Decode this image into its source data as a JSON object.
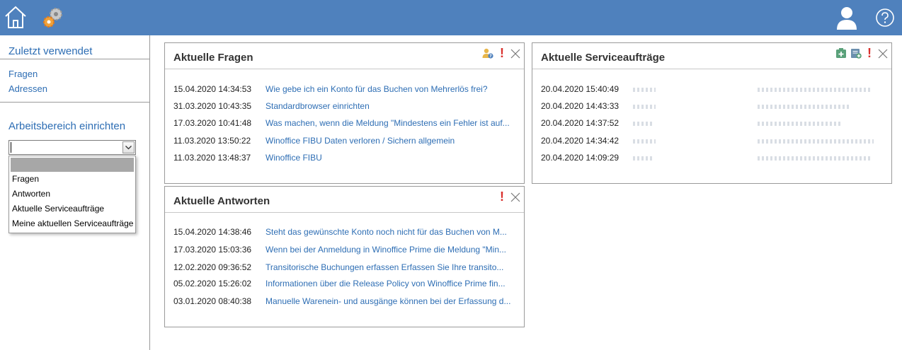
{
  "colors": {
    "topbar": "#4f81bd",
    "link": "#2e6eb4",
    "alert": "#d9302c"
  },
  "topbar": {
    "icons": [
      "home-icon",
      "gears-icon",
      "user-icon",
      "help-icon"
    ]
  },
  "sidebar": {
    "recent_heading": "Zuletzt verwendet",
    "recent_items": [
      "Fragen",
      "Adressen"
    ],
    "workspace_heading": "Arbeitsbereich einrichten",
    "combo": {
      "value": "",
      "options": [
        "",
        "Fragen",
        "Antworten",
        "Aktuelle Serviceaufträge",
        "Meine aktuellen Serviceaufträge"
      ]
    }
  },
  "panels": {
    "fragen": {
      "title": "Aktuelle Fragen",
      "rows": [
        {
          "date": "15.04.2020 14:34:53",
          "text": "Wie gebe ich ein Konto für das Buchen von Mehrerlös frei?"
        },
        {
          "date": "31.03.2020 10:43:35",
          "text": "Standardbrowser einrichten"
        },
        {
          "date": "17.03.2020 10:41:48",
          "text": "Was machen, wenn die Meldung \"Mindestens ein Fehler ist auf..."
        },
        {
          "date": "11.03.2020 13:50:22",
          "text": "Winoffice FIBU Daten verloren / Sichern allgemein"
        },
        {
          "date": "11.03.2020 13:48:37",
          "text": "Winoffice FIBU"
        }
      ]
    },
    "antworten": {
      "title": "Aktuelle Antworten",
      "rows": [
        {
          "date": "15.04.2020 14:38:46",
          "text": "Steht das gewünschte Konto noch nicht für das Buchen von M..."
        },
        {
          "date": "17.03.2020 15:03:36",
          "text": "Wenn bei der Anmeldung in Winoffice Prime die Meldung \"Min..."
        },
        {
          "date": "12.02.2020 09:36:52",
          "text": "Transitorische Buchungen erfassen   Erfassen Sie Ihre transito..."
        },
        {
          "date": "05.02.2020 15:26:02",
          "text": "Informationen über die Release Policy von Winoffice Prime fin..."
        },
        {
          "date": "03.01.2020 08:40:38",
          "text": "Manuelle Warenein- und ausgänge können bei der Erfassung d..."
        }
      ]
    },
    "service": {
      "title": "Aktuelle Serviceaufträge",
      "rows": [
        {
          "date": "20.04.2020 15:40:49"
        },
        {
          "date": "20.04.2020 14:43:33"
        },
        {
          "date": "20.04.2020 14:37:52"
        },
        {
          "date": "20.04.2020 14:34:42"
        },
        {
          "date": "20.04.2020 14:09:29"
        }
      ]
    }
  }
}
